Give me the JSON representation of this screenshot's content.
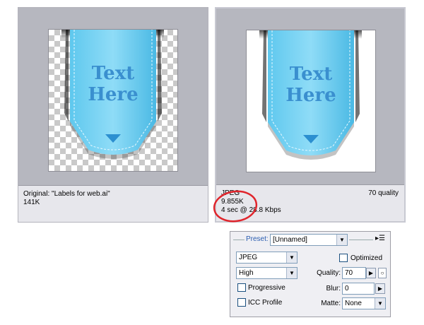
{
  "panels": {
    "original": {
      "caption": "Original: \"Labels for web.ai\"",
      "size": "141K",
      "label_text": [
        "Text",
        "Here"
      ]
    },
    "optimized": {
      "format": "JPEG",
      "size": "9.855K",
      "download_time": "4 sec @ 28.8 Kbps",
      "quality_note": "70 quality",
      "label_text": [
        "Text",
        "Here"
      ]
    }
  },
  "settings": {
    "preset_label": "Preset:",
    "preset_value": "[Unnamed]",
    "format_value": "JPEG",
    "compression_value": "High",
    "optimized_label": "Optimized",
    "optimized_checked": false,
    "quality_label": "Quality:",
    "quality_value": "70",
    "progressive_label": "Progressive",
    "progressive_checked": false,
    "blur_label": "Blur:",
    "blur_value": "0",
    "icc_label": "ICC Profile",
    "icc_checked": false,
    "matte_label": "Matte:",
    "matte_value": "None"
  },
  "icons": {
    "dropdown": "chevron-down-icon",
    "stepper": "triangle-right-icon",
    "panel_menu": "menu-icon"
  },
  "colors": {
    "ribbon": "#4ab9e4",
    "ribbon_text": "#3a8fcf",
    "annotation_circle": "#e0252c",
    "preset_label": "#2a5db0"
  }
}
